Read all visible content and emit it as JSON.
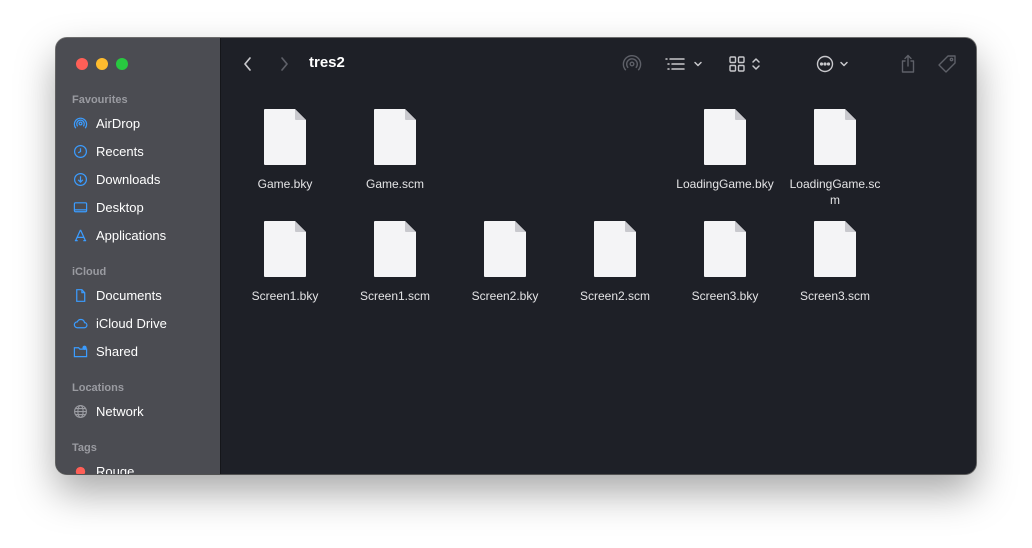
{
  "window": {
    "title": "tres2"
  },
  "sidebar": {
    "sections": [
      {
        "label": "Favourites",
        "items": [
          {
            "label": "AirDrop",
            "icon": "airdrop-icon"
          },
          {
            "label": "Recents",
            "icon": "clock-icon"
          },
          {
            "label": "Downloads",
            "icon": "download-icon"
          },
          {
            "label": "Desktop",
            "icon": "desktop-icon"
          },
          {
            "label": "Applications",
            "icon": "applications-icon"
          }
        ]
      },
      {
        "label": "iCloud",
        "items": [
          {
            "label": "Documents",
            "icon": "document-icon"
          },
          {
            "label": "iCloud Drive",
            "icon": "cloud-icon"
          },
          {
            "label": "Shared",
            "icon": "shared-folder-icon"
          }
        ]
      },
      {
        "label": "Locations",
        "items": [
          {
            "label": "Network",
            "icon": "globe-icon"
          }
        ]
      },
      {
        "label": "Tags",
        "items": [
          {
            "label": "Rouge",
            "icon": "tag-dot-icon",
            "color": "#ff5f57"
          }
        ]
      }
    ]
  },
  "toolbar": {
    "icons": [
      "back-icon",
      "forward-icon",
      "airdrop-icon",
      "list-view-icon",
      "grid-view-icon",
      "more-actions-icon",
      "share-icon",
      "tag-icon",
      "search-icon"
    ]
  },
  "files": [
    {
      "name": "Game.bky"
    },
    {
      "name": "Game.scm"
    },
    {
      "name": "LoadingGame.bky"
    },
    {
      "name": "LoadingGame.scm"
    },
    {
      "name": "Screen1.bky"
    },
    {
      "name": "Screen1.scm"
    },
    {
      "name": "Screen2.bky"
    },
    {
      "name": "Screen2.scm"
    },
    {
      "name": "Screen3.bky"
    },
    {
      "name": "Screen3.scm"
    }
  ],
  "colors": {
    "accent": "#0a84ff",
    "sidebar_icon": "#3b9cff",
    "tag_red": "#ff5f57"
  }
}
